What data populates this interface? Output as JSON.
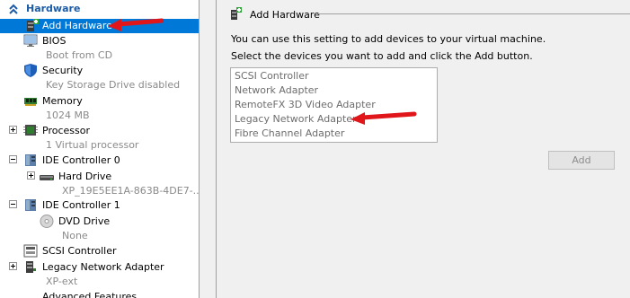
{
  "sidebar": {
    "section_title": "Hardware",
    "items": [
      {
        "label": "Add Hardware",
        "sub": ""
      },
      {
        "label": "BIOS",
        "sub": "Boot from CD"
      },
      {
        "label": "Security",
        "sub": "Key Storage Drive disabled"
      },
      {
        "label": "Memory",
        "sub": "1024 MB"
      },
      {
        "label": "Processor",
        "sub": "1 Virtual processor"
      },
      {
        "label": "IDE Controller 0",
        "sub": ""
      },
      {
        "label": "Hard Drive",
        "sub": "XP_19E5EE1A-863B-4DE7-..."
      },
      {
        "label": "IDE Controller 1",
        "sub": ""
      },
      {
        "label": "DVD Drive",
        "sub": "None"
      },
      {
        "label": "SCSI Controller",
        "sub": ""
      },
      {
        "label": "Legacy Network Adapter",
        "sub": "XP-ext"
      },
      {
        "label": "Advanced Features",
        "sub": ""
      }
    ]
  },
  "main": {
    "group_title": "Add Hardware",
    "description": "You can use this setting to add devices to your virtual machine.",
    "instruction": "Select the devices you want to add and click the Add button.",
    "devices": [
      "SCSI Controller",
      "Network Adapter",
      "RemoteFX 3D Video Adapter",
      "Legacy Network Adapter",
      "Fibre Channel Adapter"
    ],
    "add_button_label": "Add"
  },
  "colors": {
    "selection": "#0078d7",
    "section_title": "#1c5ba6",
    "annotation_arrow": "#e0161b",
    "disabled_text": "#8d8d8d"
  },
  "icons": {
    "section_collapse": "double-chevron-up-icon",
    "add_hardware": "add-hardware-icon",
    "bios": "monitor-icon",
    "security": "shield-icon",
    "memory": "memory-chip-icon",
    "processor": "processor-chip-icon",
    "ide_controller": "controller-icon",
    "hard_drive": "hard-drive-icon",
    "dvd_drive": "dvd-disc-icon",
    "scsi_controller": "scsi-controller-icon",
    "network_adapter": "network-adapter-icon"
  }
}
